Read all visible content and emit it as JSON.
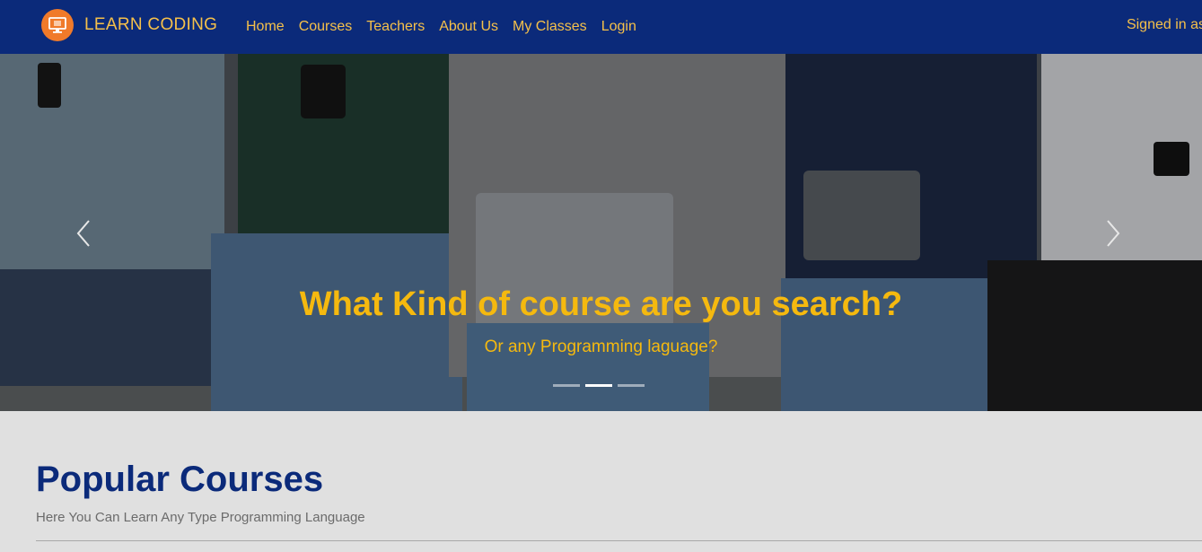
{
  "brand": {
    "name": "LEARN CODING",
    "logo_icon": "computer-monitor-icon",
    "logo_color": "#f07a2a"
  },
  "nav": {
    "links": [
      {
        "label": "Home"
      },
      {
        "label": "Courses"
      },
      {
        "label": "Teachers"
      },
      {
        "label": "About Us"
      },
      {
        "label": "My Classes"
      },
      {
        "label": "Login"
      }
    ],
    "signed_in_text": "Signed in as"
  },
  "hero": {
    "title": "What Kind of course are you search?",
    "subtitle": "Or any Programming laguage?",
    "prev_icon": "chevron-left-icon",
    "next_icon": "chevron-right-icon",
    "slide_count": 3,
    "active_slide": 2
  },
  "section": {
    "title": "Popular Courses",
    "subtitle": "Here You Can Learn Any Type Programming Language"
  },
  "colors": {
    "navbar": "#0b2a7a",
    "accent": "#f5c04a",
    "caption": "#f5b90f",
    "section_bg": "#e0e0e0"
  }
}
